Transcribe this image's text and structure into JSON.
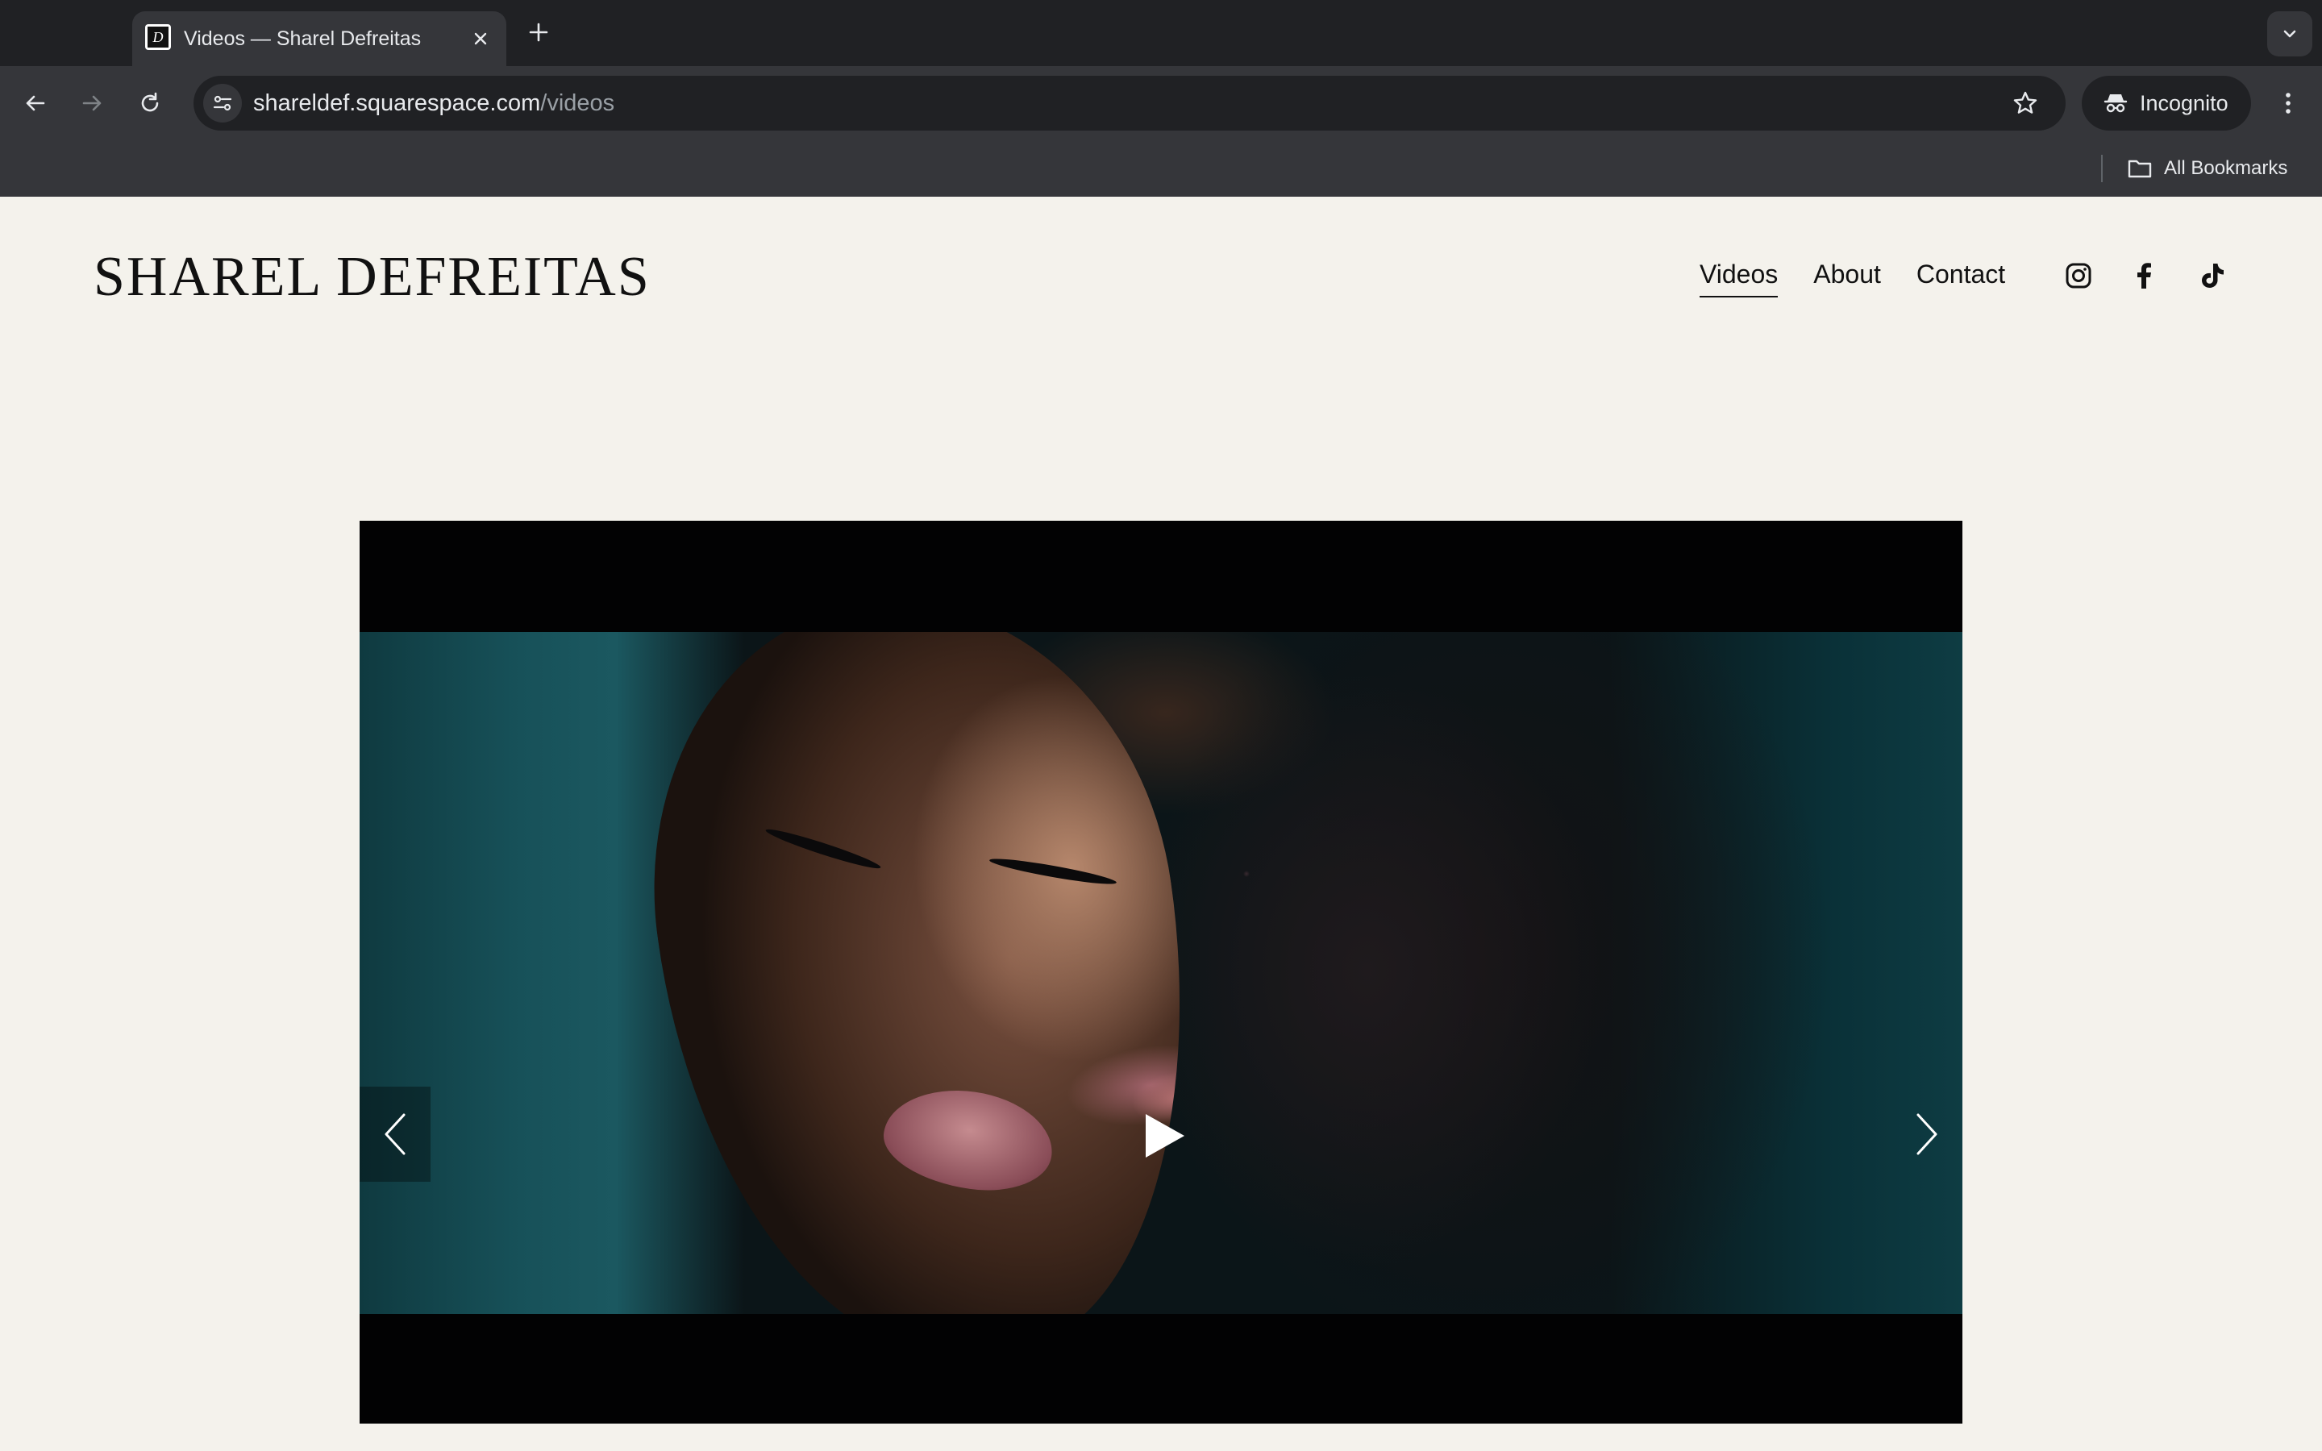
{
  "browser": {
    "tab_title": "Videos — Sharel Defreitas",
    "favicon_letter": "D",
    "url_host": "shareldef.squarespace.com",
    "url_path": "/videos",
    "incognito_label": "Incognito",
    "bookmarks_label": "All Bookmarks"
  },
  "site": {
    "brand": "SHAREL DEFREITAS",
    "nav": [
      {
        "label": "Videos",
        "active": true
      },
      {
        "label": "About",
        "active": false
      },
      {
        "label": "Contact",
        "active": false
      }
    ],
    "social": [
      "instagram-icon",
      "facebook-icon",
      "tiktok-icon"
    ]
  },
  "video": {
    "controls": [
      "previous-arrow-icon",
      "play-icon",
      "next-arrow-icon"
    ]
  },
  "colors": {
    "page_bg": "#f4f2ec",
    "chrome_dark": "#202124",
    "chrome_mid": "#35363a",
    "text_dark": "#111111"
  }
}
